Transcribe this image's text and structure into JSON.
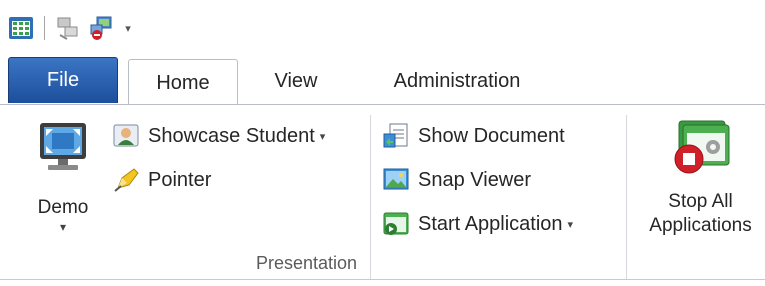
{
  "quick_access": {
    "icons": [
      "calendar-grid-icon",
      "network-computers-icon",
      "disconnect-computers-icon"
    ],
    "dropdown_glyph": "▾"
  },
  "tabs": [
    {
      "label": "File",
      "active": false
    },
    {
      "label": "Home",
      "active": true
    },
    {
      "label": "View",
      "active": false
    },
    {
      "label": "Administration",
      "active": false
    }
  ],
  "ribbon": {
    "presentation_group": {
      "label": "Presentation",
      "demo": {
        "label": "Demo",
        "dropdown": "▾"
      },
      "showcase_student": {
        "label": "Showcase Student",
        "dropdown": "▾"
      },
      "pointer": {
        "label": "Pointer"
      },
      "show_document": {
        "label": "Show Document"
      },
      "snap_viewer": {
        "label": "Snap Viewer"
      },
      "start_application": {
        "label": "Start Application",
        "dropdown": "▾"
      }
    },
    "stop_all": {
      "line1": "Stop All",
      "line2": "Applications"
    }
  },
  "colors": {
    "file_tab": "#2a62b2",
    "accent_green": "#4caf50",
    "stop_red": "#d0202a"
  }
}
